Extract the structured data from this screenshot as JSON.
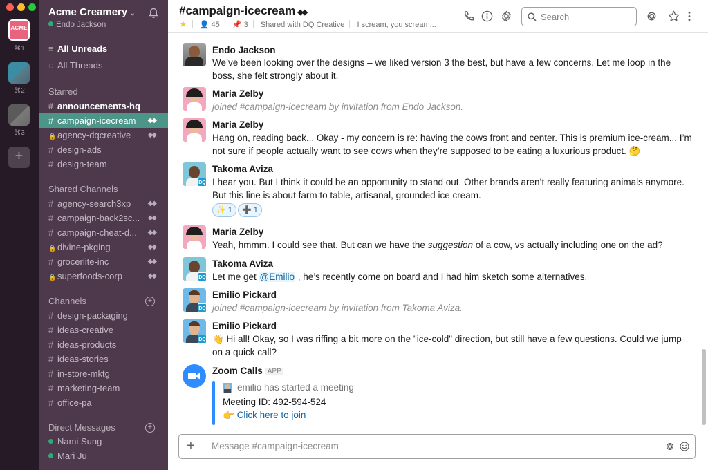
{
  "workspace_rail": {
    "items": [
      {
        "logo_text": "ACME",
        "shortcut": "⌘1"
      },
      {
        "shortcut": "⌘2"
      },
      {
        "shortcut": "⌘3"
      }
    ],
    "add_label": "+"
  },
  "sidebar": {
    "team_name": "Acme Creamery",
    "user_name": "Endo Jackson",
    "nav": [
      {
        "label": "All Unreads"
      },
      {
        "label": "All Threads"
      }
    ],
    "sections": {
      "starred": "Starred",
      "shared": "Shared Channels",
      "channels": "Channels",
      "dms": "Direct Messages"
    },
    "starred": [
      {
        "name": "announcements-hq",
        "prefix": "#"
      },
      {
        "name": "campaign-icecream",
        "prefix": "#"
      },
      {
        "name": "agency-dqcreative",
        "prefix": "🔒"
      },
      {
        "name": "design-ads",
        "prefix": "#"
      },
      {
        "name": "design-team",
        "prefix": "#"
      }
    ],
    "shared_channels": [
      {
        "name": "agency-search3xp",
        "prefix": "#"
      },
      {
        "name": "campaign-back2sc...",
        "prefix": "#"
      },
      {
        "name": "campaign-cheat-d...",
        "prefix": "#"
      },
      {
        "name": "divine-pkging",
        "prefix": "🔒"
      },
      {
        "name": "grocerlite-inc",
        "prefix": "#"
      },
      {
        "name": "superfoods-corp",
        "prefix": "🔒"
      }
    ],
    "channels": [
      {
        "name": "design-packaging",
        "prefix": "#"
      },
      {
        "name": "ideas-creative",
        "prefix": "#"
      },
      {
        "name": "ideas-products",
        "prefix": "#"
      },
      {
        "name": "ideas-stories",
        "prefix": "#"
      },
      {
        "name": "in-store-mktg",
        "prefix": "#"
      },
      {
        "name": "marketing-team",
        "prefix": "#"
      },
      {
        "name": "office-pa",
        "prefix": "#"
      }
    ],
    "direct_messages": [
      {
        "name": "Nami Sung"
      },
      {
        "name": "Mari Ju"
      }
    ]
  },
  "header": {
    "channel_title": "#campaign-icecream",
    "members": "45",
    "pins": "3",
    "shared_with": "Shared with DQ Creative",
    "topic": "I scream, you scream...",
    "search_placeholder": "Search"
  },
  "messages": [
    {
      "sender": "Endo Jackson",
      "text": "We’ve been looking over the designs – we liked version 3 the best, but have a few concerns. Let me loop in the boss, she felt strongly about it."
    },
    {
      "sender": "Maria Zelby",
      "text": "joined #campaign-icecream by invitation from Endo Jackson."
    },
    {
      "sender": "Maria Zelby",
      "text": "Hang on, reading back... Okay - my concern is re: having the cows front and center. This is premium ice-cream... I’m not sure if people actually want to see cows when they’re supposed to be eating a luxurious product. 🤔"
    },
    {
      "sender": "Takoma Aviza",
      "text": "I hear you. But I think it could be an opportunity to stand out. Other brands aren’t really featuring animals anymore. But this line is about farm to table, artisanal, grounded ice cream.",
      "reactions": [
        {
          "emoji": "✨",
          "count": "1"
        },
        {
          "emoji": "➕",
          "count": "1"
        }
      ]
    },
    {
      "sender": "Maria Zelby",
      "text_before": "Yeah, hmmm. I could see that. But can we have the ",
      "text_emph": "suggestion",
      "text_after": " of a cow, vs actually including one on the ad?"
    },
    {
      "sender": "Takoma Aviza",
      "text_before": "Let me get ",
      "mention": "@Emilio",
      "text_after": " , he’s recently come on board and I had him sketch some alternatives."
    },
    {
      "sender": "Emilio Pickard",
      "text": "joined #campaign-icecream by invitation from Takoma Aviza."
    },
    {
      "sender": "Emilio Pickard",
      "text": "👋  Hi all! Okay, so I was riffing a bit more on the \"ice-cold\" direction, but still have a few questions. Could we jump on a quick call?"
    },
    {
      "sender": "Zoom Calls",
      "app_tag": "APP",
      "started": "emilio has started a meeting",
      "meeting_id": "Meeting ID: 492-594-524",
      "join_link": "Click here to join"
    }
  ],
  "badges": {
    "dq": "DQ"
  },
  "composer": {
    "placeholder": "Message #campaign-icecream"
  },
  "colors": {
    "rail_bg": "#261a27",
    "sidebar_bg": "#4d394b",
    "active_channel": "#4c9689",
    "presence": "#2bac76",
    "link": "#1264a3",
    "zoom_blue": "#2d8cff"
  }
}
